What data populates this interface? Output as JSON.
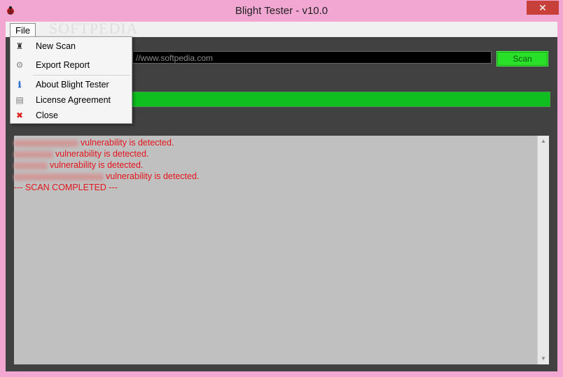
{
  "window": {
    "title": "Blight Tester - v10.0",
    "close_glyph": "✕",
    "app_icon": "ladybug-icon"
  },
  "menubar": {
    "file_label": "File"
  },
  "menu": {
    "items": [
      {
        "label": "New Scan",
        "icon": "binoculars-icon",
        "glyph": "♜"
      },
      {
        "label": "Export Report",
        "icon": "export-icon",
        "glyph": "⚙"
      },
      {
        "label": "About Blight Tester",
        "icon": "info-icon",
        "glyph": "ℹ"
      },
      {
        "label": "License Agreement",
        "icon": "document-icon",
        "glyph": "▤"
      },
      {
        "label": "Close",
        "icon": "close-icon",
        "glyph": "✖"
      }
    ]
  },
  "scan": {
    "url_value": "//www.softpedia.com",
    "button_label": "Scan"
  },
  "progress": {
    "value": 1.0
  },
  "log": {
    "lines": [
      "vulnerability is detected.",
      "vulnerability is detected.",
      "vulnerability is detected.",
      "vulnerability is detected.",
      "--- SCAN COMPLETED ---"
    ]
  },
  "watermark": "SOFTPEDIA",
  "colors": {
    "titlebar": "#f2a7d2",
    "log_text": "#e4141a",
    "progress": "#0fbf1f",
    "scan_button": "#28e028"
  }
}
